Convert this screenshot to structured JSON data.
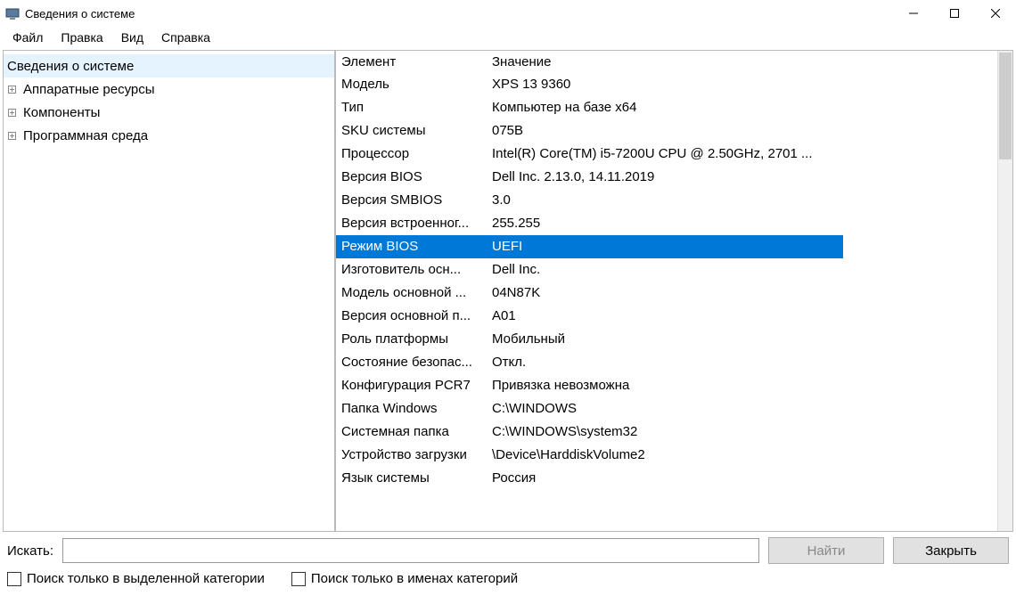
{
  "titlebar": {
    "title": "Сведения о системе"
  },
  "menu": {
    "file": "Файл",
    "edit": "Правка",
    "view": "Вид",
    "help": "Справка"
  },
  "tree": {
    "root": "Сведения о системе",
    "items": [
      {
        "label": "Аппаратные ресурсы",
        "expandable": true
      },
      {
        "label": "Компоненты",
        "expandable": true
      },
      {
        "label": "Программная среда",
        "expandable": true
      }
    ]
  },
  "columns": {
    "name": "Элемент",
    "value": "Значение"
  },
  "rows": [
    {
      "name": "Модель",
      "value": "XPS 13 9360"
    },
    {
      "name": "Тип",
      "value": "Компьютер на базе x64"
    },
    {
      "name": "SKU системы",
      "value": "075B"
    },
    {
      "name": "Процессор",
      "value": "Intel(R) Core(TM) i5-7200U CPU @ 2.50GHz, 2701 ..."
    },
    {
      "name": "Версия BIOS",
      "value": "Dell Inc. 2.13.0, 14.11.2019"
    },
    {
      "name": "Версия SMBIOS",
      "value": "3.0"
    },
    {
      "name": "Версия встроенног...",
      "value": "255.255"
    },
    {
      "name": "Режим BIOS",
      "value": "UEFI",
      "selected": true
    },
    {
      "name": "Изготовитель осн...",
      "value": "Dell Inc."
    },
    {
      "name": "Модель основной ...",
      "value": "04N87K"
    },
    {
      "name": "Версия основной п...",
      "value": "A01"
    },
    {
      "name": "Роль платформы",
      "value": "Мобильный"
    },
    {
      "name": "Состояние безопас...",
      "value": "Откл."
    },
    {
      "name": "Конфигурация PCR7",
      "value": "Привязка невозможна"
    },
    {
      "name": "Папка Windows",
      "value": "C:\\WINDOWS"
    },
    {
      "name": "Системная папка",
      "value": "C:\\WINDOWS\\system32"
    },
    {
      "name": "Устройство загрузки",
      "value": "\\Device\\HarddiskVolume2"
    },
    {
      "name": "Язык системы",
      "value": "Россия"
    }
  ],
  "footer": {
    "search_label": "Искать:",
    "search_value": "",
    "find_btn": "Найти",
    "close_btn": "Закрыть",
    "chk_selected": "Поиск только в выделенной категории",
    "chk_names": "Поиск только в именах категорий"
  }
}
